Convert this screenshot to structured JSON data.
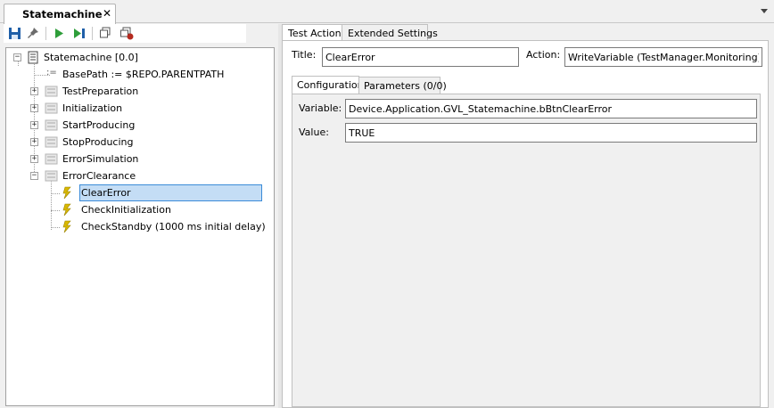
{
  "document_tab": {
    "title": "Statemachine",
    "close_glyph": "✕"
  },
  "toolbar": {
    "buttons": [
      {
        "icon": "save-icon"
      },
      {
        "icon": "pin-icon"
      },
      {
        "icon": "play-icon"
      },
      {
        "icon": "step-icon"
      },
      {
        "icon": "copy-icon"
      },
      {
        "icon": "record-icon"
      }
    ]
  },
  "tree": {
    "root": {
      "label": "Statemachine [0.0]",
      "expander": "−"
    },
    "items": [
      {
        "label": "BasePath := $REPO.PARENTPATH",
        "icon": "assignment-icon"
      },
      {
        "label": "TestPreparation",
        "expander": "+",
        "icon": "sequence-icon"
      },
      {
        "label": "Initialization",
        "expander": "+",
        "icon": "sequence-icon"
      },
      {
        "label": "StartProducing",
        "expander": "+",
        "icon": "sequence-icon"
      },
      {
        "label": "StopProducing",
        "expander": "+",
        "icon": "sequence-icon"
      },
      {
        "label": "ErrorSimulation",
        "expander": "+",
        "icon": "sequence-icon"
      },
      {
        "label": "ErrorClearance",
        "expander": "−",
        "icon": "sequence-icon"
      }
    ],
    "children": [
      {
        "label": "ClearError",
        "icon": "action-icon",
        "selected": true
      },
      {
        "label": "CheckInitialization",
        "icon": "action-icon"
      },
      {
        "label": "CheckStandby (1000 ms initial delay)",
        "icon": "action-icon"
      }
    ]
  },
  "right": {
    "tabs": [
      "Test Action",
      "Extended Settings"
    ],
    "active_tab": "Test Action",
    "title_label": "Title:",
    "title_value": "ClearError",
    "action_label": "Action:",
    "action_value": "WriteVariable (TestManager.Monitoring)",
    "inner_tabs": [
      "Configuration",
      "Parameters (0/0)"
    ],
    "active_inner_tab": "Configuration",
    "variable_label": "Variable:",
    "variable_value": "Device.Application.GVL_Statemachine.bBtnClearError",
    "value_label": "Value:",
    "value_value": "TRUE"
  },
  "colors": {
    "selection_fill": "#c4ddf5",
    "selection_border": "#3b8bd8",
    "play_green": "#2e9e3a",
    "save_blue": "#1f5fa8",
    "action_yellow": "#d9b800"
  }
}
